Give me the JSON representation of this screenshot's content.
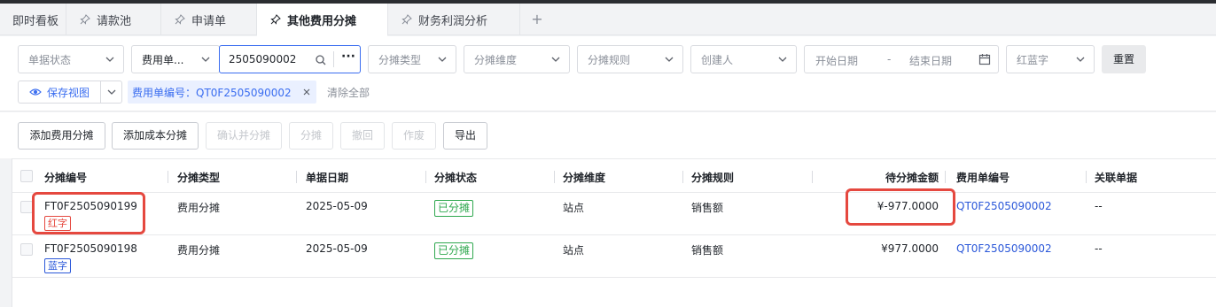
{
  "tabs": [
    {
      "label": "即时看板",
      "pinned": false
    },
    {
      "label": "请款池",
      "pinned": true
    },
    {
      "label": "申请单",
      "pinned": true
    },
    {
      "label": "其他费用分摊",
      "pinned": true,
      "active": true
    },
    {
      "label": "财务利润分析",
      "pinned": true
    }
  ],
  "add_tab_symbol": "+",
  "filters": {
    "doc_status": "单据状态",
    "doc_no_field": "费用单...",
    "search_value": "2505090002",
    "more_symbol": "···",
    "alloc_type": "分摊类型",
    "alloc_dimension": "分摊维度",
    "alloc_rule": "分摊规则",
    "creator": "创建人",
    "start_date": "开始日期",
    "date_sep": "-",
    "end_date": "结束日期",
    "red_blue": "红蓝字",
    "reset": "重置",
    "save_view": "保存视图",
    "active_chip": "费用单编号：QT0F2505090002",
    "clear_all": "清除全部"
  },
  "toolbar": {
    "add_expense_alloc": "添加费用分摊",
    "add_cost_alloc": "添加成本分摊",
    "confirm_and_alloc": "确认并分摊",
    "alloc": "分摊",
    "withdraw": "撤回",
    "void": "作废",
    "export": "导出"
  },
  "table": {
    "headers": [
      "分摊编号",
      "分摊类型",
      "单据日期",
      "分摊状态",
      "分摊维度",
      "分摊规则",
      "待分摊金额",
      "费用单编号",
      "关联单据"
    ],
    "rows": [
      {
        "id": "FT0F2505090199",
        "tag": "红字",
        "tag_color": "red",
        "type": "费用分摊",
        "date": "2025-05-09",
        "status": "已分摊",
        "dimension": "站点",
        "rule": "销售额",
        "amount": "¥-977.0000",
        "expense_no": "QT0F2505090002",
        "related": "--"
      },
      {
        "id": "FT0F2505090198",
        "tag": "蓝字",
        "tag_color": "blue",
        "type": "费用分摊",
        "date": "2025-05-09",
        "status": "已分摊",
        "dimension": "站点",
        "rule": "销售额",
        "amount": "¥977.0000",
        "expense_no": "QT0F2505090002",
        "related": "--"
      }
    ]
  },
  "colors": {
    "accent": "#3a6df0",
    "link": "#2b58d9",
    "success": "#2fa84f",
    "danger": "#e5483f"
  }
}
